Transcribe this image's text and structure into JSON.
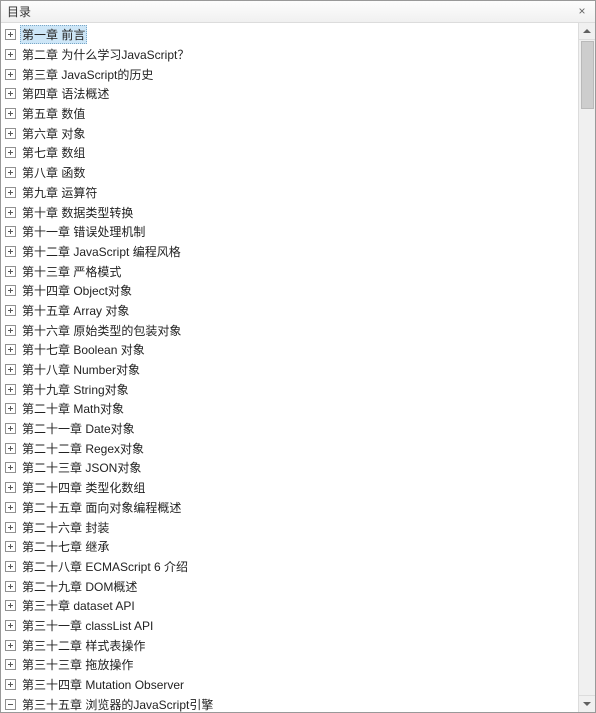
{
  "window": {
    "title": "目录",
    "close_label": "×"
  },
  "tree": {
    "items": [
      {
        "label": "第一章 前言",
        "selected": true,
        "expanded": false
      },
      {
        "label": "第二章 为什么学习JavaScript？",
        "expanded": false
      },
      {
        "label": "第三章 JavaScript的历史",
        "expanded": false
      },
      {
        "label": "第四章 语法概述",
        "expanded": false
      },
      {
        "label": "第五章 数值",
        "expanded": false
      },
      {
        "label": "第六章 对象",
        "expanded": false
      },
      {
        "label": "第七章 数组",
        "expanded": false
      },
      {
        "label": "第八章 函数",
        "expanded": false
      },
      {
        "label": "第九章 运算符",
        "expanded": false
      },
      {
        "label": "第十章 数据类型转换",
        "expanded": false
      },
      {
        "label": "第十一章 错误处理机制",
        "expanded": false
      },
      {
        "label": "第十二章 JavaScript 编程风格",
        "expanded": false
      },
      {
        "label": "第十三章 严格模式",
        "expanded": false
      },
      {
        "label": "第十四章 Object对象",
        "expanded": false
      },
      {
        "label": "第十五章 Array 对象",
        "expanded": false
      },
      {
        "label": "第十六章 原始类型的包装对象",
        "expanded": false
      },
      {
        "label": "第十七章 Boolean 对象",
        "expanded": false
      },
      {
        "label": "第十八章 Number对象",
        "expanded": false
      },
      {
        "label": "第十九章 String对象",
        "expanded": false
      },
      {
        "label": "第二十章 Math对象",
        "expanded": false
      },
      {
        "label": "第二十一章 Date对象",
        "expanded": false
      },
      {
        "label": "第二十二章 Regex对象",
        "expanded": false
      },
      {
        "label": "第二十三章 JSON对象",
        "expanded": false
      },
      {
        "label": "第二十四章 类型化数组",
        "expanded": false
      },
      {
        "label": "第二十五章 面向对象编程概述",
        "expanded": false
      },
      {
        "label": "第二十六章 封装",
        "expanded": false
      },
      {
        "label": "第二十七章 继承",
        "expanded": false
      },
      {
        "label": "第二十八章 ECMAScript 6 介绍",
        "expanded": false
      },
      {
        "label": "第二十九章 DOM概述",
        "expanded": false
      },
      {
        "label": "第三十章 dataset API",
        "expanded": false
      },
      {
        "label": "第三十一章 classList API",
        "expanded": false
      },
      {
        "label": "第三十二章 样式表操作",
        "expanded": false
      },
      {
        "label": "第三十三章 拖放操作",
        "expanded": false
      },
      {
        "label": "第三十四章 Mutation Observer",
        "expanded": false
      },
      {
        "label": "第三十五章 浏览器的JavaScript引擎",
        "expanded": true
      }
    ]
  }
}
